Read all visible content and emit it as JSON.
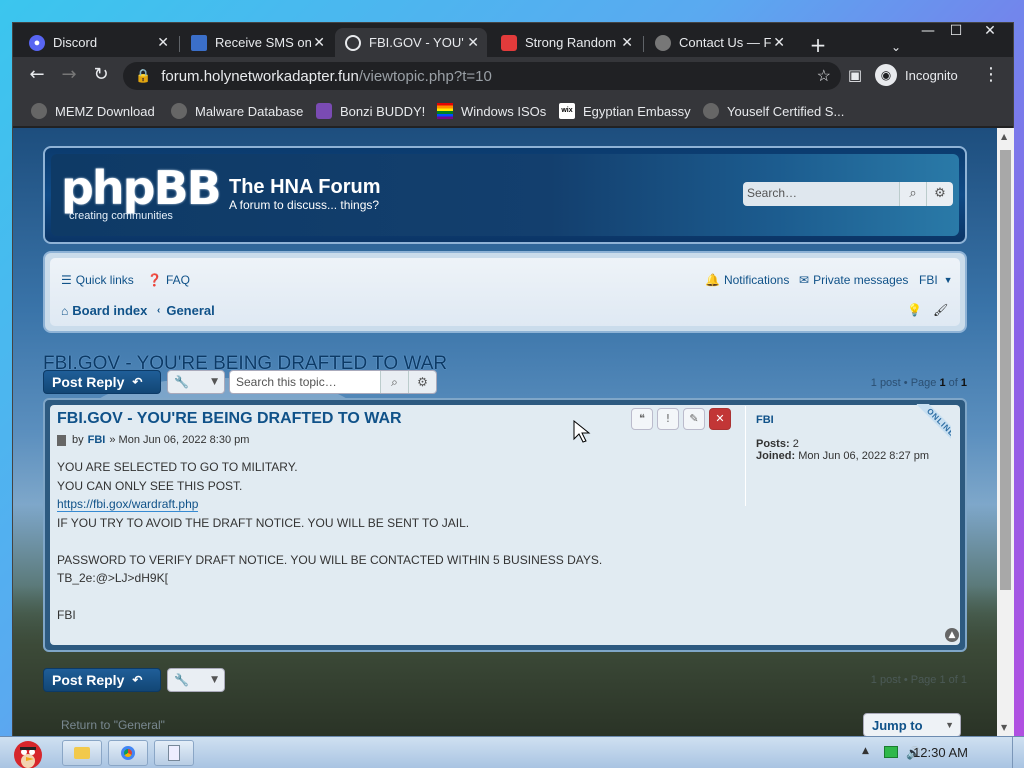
{
  "browser": {
    "tabs": [
      {
        "title": "Discord",
        "icon": "discord-icon",
        "active": false
      },
      {
        "title": "Receive SMS on",
        "icon": "sms-site-icon",
        "active": false
      },
      {
        "title": "FBI.GOV - YOU'",
        "icon": "globe-icon",
        "active": true
      },
      {
        "title": "Strong Random",
        "icon": "password-icon",
        "active": false
      },
      {
        "title": "Contact Us — F",
        "icon": "contact-icon",
        "active": false
      }
    ],
    "url_host": "forum.holynetworkadapter.fun",
    "url_path": "/viewtopic.php?t=10",
    "profile_label": "Incognito",
    "bookmarks": [
      {
        "label": "MEMZ Download",
        "icon": "globe-icon"
      },
      {
        "label": "Malware Database",
        "icon": "globe-icon"
      },
      {
        "label": "Bonzi BUDDY!",
        "icon": "bonzi-icon"
      },
      {
        "label": "Windows ISOs",
        "icon": "rainbow-flag-icon"
      },
      {
        "label": "Egyptian Embassy",
        "icon": "wix-icon"
      },
      {
        "label": "Youself Certified S...",
        "icon": "globe-icon"
      }
    ]
  },
  "forum": {
    "logo_text": "phpBB",
    "logo_sub": "creating communities",
    "site_name": "The HNA Forum",
    "site_desc": "A forum to discuss... things?",
    "search_placeholder": "Search…",
    "nav": {
      "quick_links": "Quick links",
      "faq": "FAQ",
      "notifications": "Notifications",
      "private_messages": "Private messages",
      "user": "FBI",
      "board_index": "Board index",
      "crumb": "General"
    },
    "topic_title": "FBI.GOV - YOU'RE BEING DRAFTED TO WAR",
    "post_reply": "Post Reply",
    "topic_search_placeholder": "Search this topic…",
    "pagination": {
      "prefix": "1 post • Page ",
      "page": "1",
      "of": " of ",
      "total": "1"
    },
    "post": {
      "title": "FBI.GOV - YOU'RE BEING DRAFTED TO WAR",
      "by": "by",
      "author": "FBI",
      "date": "» Mon Jun 06, 2022 8:30 pm",
      "line1": "YOU ARE SELECTED TO GO TO MILITARY.",
      "line2": "YOU CAN ONLY SEE THIS POST.",
      "link": "https://fbi.gox/wardraft.php",
      "line3": "IF YOU TRY TO AVOID THE DRAFT NOTICE. YOU WILL BE SENT TO JAIL.",
      "line4": "PASSWORD TO VERIFY DRAFT NOTICE. YOU WILL BE CONTACTED WITHIN 5 BUSINESS DAYS.",
      "line5": "TB_2e:@>LJ>dH9K[",
      "signature": "FBI"
    },
    "profile": {
      "name": "FBI",
      "posts_label": "Posts:",
      "posts": "2",
      "joined_label": "Joined:",
      "joined": "Mon Jun 06, 2022 8:27 pm",
      "status": "ONLINE"
    },
    "return_text": "Return to \"General\"",
    "jump_to": "Jump to",
    "bottom_pagination": "1 post • Page 1 of 1"
  },
  "taskbar": {
    "clock": "12:30 AM"
  }
}
